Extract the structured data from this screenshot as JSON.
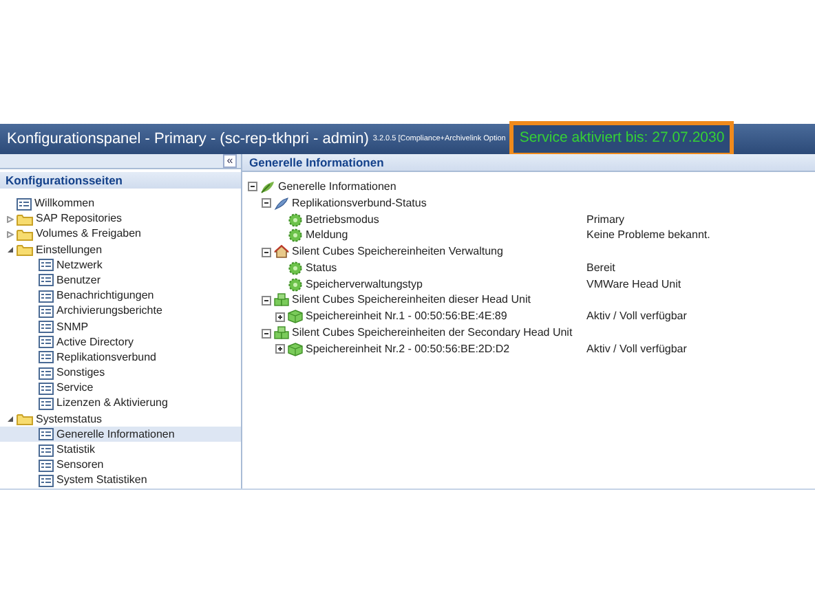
{
  "window": {
    "title": "Konfigurationspanel - Primary - (sc-rep-tkhpri - admin)",
    "version": "3.2.0.5 [Compliance+Archivelink Option",
    "service": "Service aktiviert bis: 27.07.2030"
  },
  "sidebar": {
    "collapse": "«",
    "title": "Konfigurationsseiten",
    "items": [
      {
        "kind": "page",
        "label": "Willkommen",
        "selected": false
      },
      {
        "kind": "folder",
        "label": "SAP Repositories",
        "expanded": false,
        "selected": false
      },
      {
        "kind": "folder",
        "label": "Volumes & Freigaben",
        "expanded": false,
        "selected": false
      },
      {
        "kind": "folder",
        "label": "Einstellungen",
        "expanded": true,
        "selected": false,
        "children": [
          {
            "kind": "page",
            "label": "Netzwerk",
            "selected": false
          },
          {
            "kind": "page",
            "label": "Benutzer",
            "selected": false
          },
          {
            "kind": "page",
            "label": "Benachrichtigungen",
            "selected": false
          },
          {
            "kind": "page",
            "label": "Archivierungsberichte",
            "selected": false
          },
          {
            "kind": "page",
            "label": "SNMP",
            "selected": false
          },
          {
            "kind": "page",
            "label": "Active Directory",
            "selected": false
          },
          {
            "kind": "page",
            "label": "Replikationsverbund",
            "selected": false
          },
          {
            "kind": "page",
            "label": "Sonstiges",
            "selected": false
          },
          {
            "kind": "page",
            "label": "Service",
            "selected": false
          },
          {
            "kind": "page",
            "label": "Lizenzen & Aktivierung",
            "selected": false
          }
        ]
      },
      {
        "kind": "folder",
        "label": "Systemstatus",
        "expanded": true,
        "selected": false,
        "children": [
          {
            "kind": "page",
            "label": "Generelle Informationen",
            "selected": true
          },
          {
            "kind": "page",
            "label": "Statistik",
            "selected": false
          },
          {
            "kind": "page",
            "label": "Sensoren",
            "selected": false
          },
          {
            "kind": "page",
            "label": "System Statistiken",
            "selected": false
          }
        ]
      }
    ]
  },
  "content": {
    "title": "Generelle Informationen",
    "tree": [
      {
        "kind": "leaf",
        "label": "Generelle Informationen",
        "expanded": true,
        "children": [
          {
            "kind": "feather",
            "label": "Replikationsverbund-Status",
            "expanded": true,
            "children": [
              {
                "kind": "gear",
                "label": "Betriebsmodus",
                "value": "Primary"
              },
              {
                "kind": "gear",
                "label": "Meldung",
                "value": "Keine Probleme bekannt."
              }
            ]
          },
          {
            "kind": "house",
            "label": "Silent Cubes Speichereinheiten Verwaltung",
            "expanded": true,
            "children": [
              {
                "kind": "gear",
                "label": "Status",
                "value": "Bereit"
              },
              {
                "kind": "gear",
                "label": "Speicherverwaltungstyp",
                "value": "VMWare Head Unit"
              }
            ]
          },
          {
            "kind": "cubes",
            "label": "Silent Cubes Speichereinheiten dieser Head Unit",
            "expanded": true,
            "children": [
              {
                "kind": "cube",
                "label": "Speichereinheit Nr.1 - 00:50:56:BE:4E:89",
                "expanded": false,
                "value": "Aktiv / Voll verfügbar"
              }
            ]
          },
          {
            "kind": "cubes",
            "label": "Silent Cubes Speichereinheiten der Secondary Head Unit",
            "expanded": true,
            "children": [
              {
                "kind": "cube",
                "label": "Speichereinheit Nr.2 - 00:50:56:BE:2D:D2",
                "expanded": false,
                "value": "Aktiv / Voll verfügbar"
              }
            ]
          }
        ]
      }
    ]
  }
}
